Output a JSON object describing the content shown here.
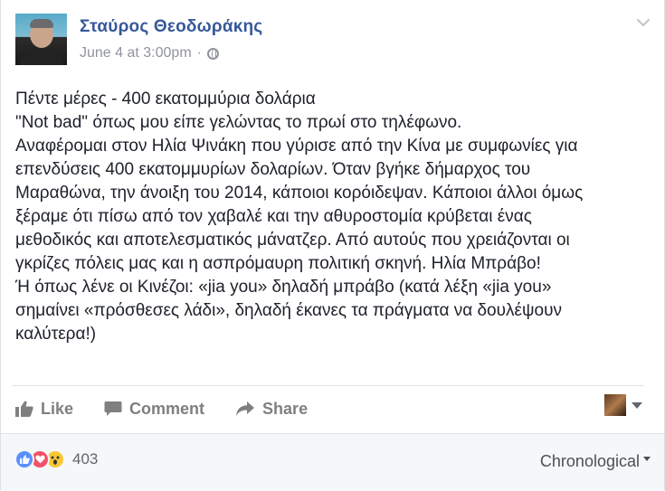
{
  "post": {
    "author": "Σταύρος Θεοδωράκης",
    "timestamp": "June 4 at 3:00pm",
    "separator": "·",
    "privacy_icon": "globe-icon",
    "menu_icon": "chevron-down-icon",
    "lines": [
      "Πέντε μέρες - 400 εκατομμύρια δολάρια",
      "\"Not bad\" όπως μου είπε γελώντας το πρωί στο τηλέφωνο.",
      "Αναφέρομαι στον Ηλία Ψινάκη που γύρισε από την Κίνα με συμφωνίες για",
      "επενδύσεις 400 εκατομμυρίων δολαρίων. Όταν βγήκε δήμαρχος του",
      "Μαραθώνα, την άνοιξη του 2014, κάποιοι κορόιδεψαν. Κάποιοι άλλοι όμως",
      "ξέραμε ότι πίσω από τον χαβαλέ και την αθυροστομία κρύβεται ένας",
      "μεθοδικός και αποτελεσματικός μάνατζερ. Από αυτούς που χρειάζονται οι",
      "γκρίζες πόλεις μας και η ασπρόμαυρη πολιτική σκηνή. Ηλία Μπράβο!",
      "Ή όπως λένε οι Κινέζοι: «jia you» δηλαδή μπράβο (κατά λέξη «jia you»",
      "σημαίνει «πρόσθεσες λάδι», δηλαδή έκανες τα πράγματα να δουλέψουν",
      "καλύτερα!)"
    ]
  },
  "actions": {
    "like_label": "Like",
    "comment_label": "Comment",
    "share_label": "Share"
  },
  "footer": {
    "reaction_count": "403",
    "sort_label": "Chronological",
    "reactions": [
      "like",
      "love",
      "wow"
    ]
  },
  "colors": {
    "link_blue": "#365899",
    "muted_gray": "#90949c",
    "like_blue": "#5890ff",
    "love_red": "#f25268",
    "wow_yellow": "#f7c832"
  }
}
